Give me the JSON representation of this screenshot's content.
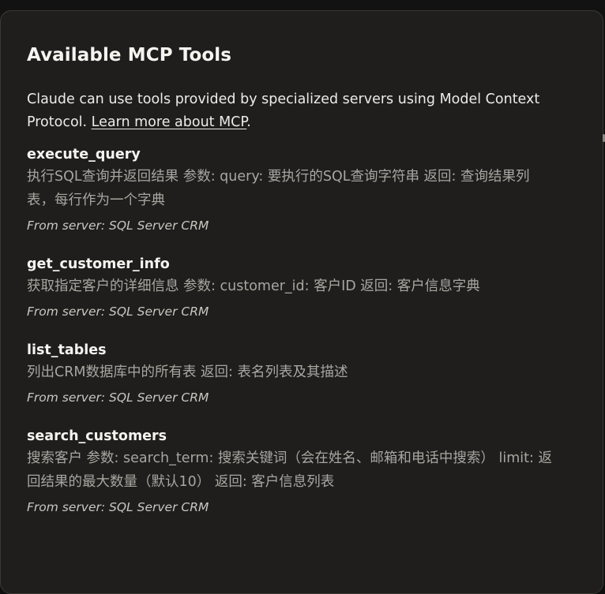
{
  "modal": {
    "title": "Available MCP Tools",
    "intro_text": "Claude can use tools provided by specialized servers using Model Context Protocol. ",
    "intro_link": "Learn more about MCP",
    "intro_end": "."
  },
  "tools": [
    {
      "name": "execute_query",
      "description": "执行SQL查询并返回结果 参数: query: 要执行的SQL查询字符串 返回: 查询结果列表，每行作为一个字典",
      "server": "From server: SQL Server CRM"
    },
    {
      "name": "get_customer_info",
      "description": "获取指定客户的详细信息 参数: customer_id: 客户ID 返回: 客户信息字典",
      "server": "From server: SQL Server CRM"
    },
    {
      "name": "list_tables",
      "description": "列出CRM数据库中的所有表 返回: 表名列表及其描述",
      "server": "From server: SQL Server CRM"
    },
    {
      "name": "search_customers",
      "description": "搜索客户 参数: search_term: 搜索关键词（会在姓名、邮箱和电话中搜索） limit: 返回结果的最大数量（默认10） 返回: 客户信息列表",
      "server": "From server: SQL Server CRM"
    }
  ]
}
